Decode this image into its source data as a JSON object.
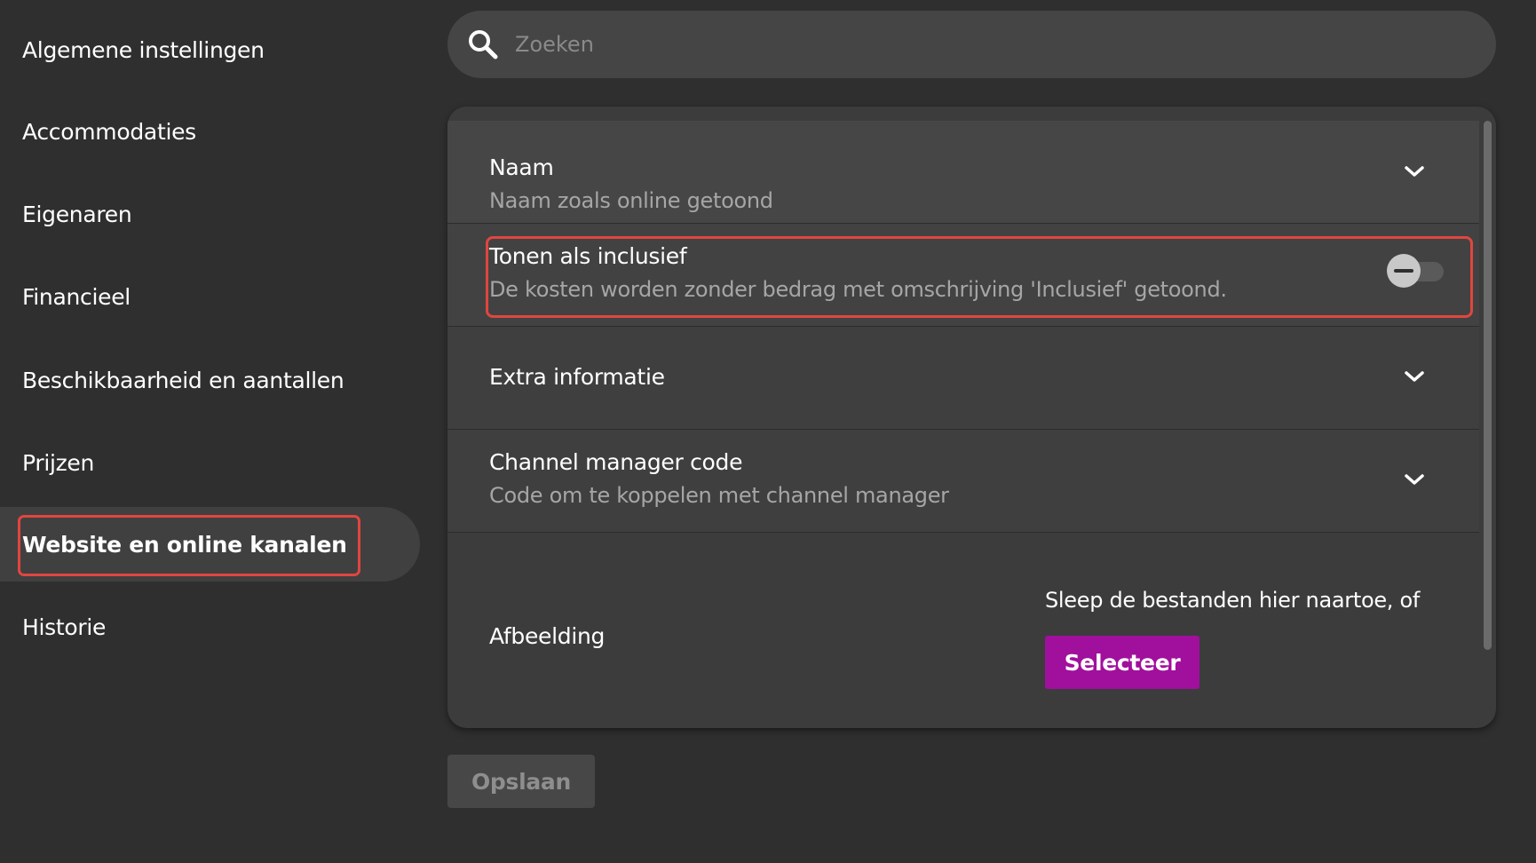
{
  "sidebar": {
    "items": [
      {
        "label": "Algemene instellingen"
      },
      {
        "label": "Accommodaties"
      },
      {
        "label": "Eigenaren"
      },
      {
        "label": "Financieel"
      },
      {
        "label": "Beschikbaarheid en aantallen"
      },
      {
        "label": "Prijzen"
      },
      {
        "label": "Website en online kanalen",
        "active": true
      },
      {
        "label": "Historie"
      }
    ]
  },
  "search": {
    "placeholder": "Zoeken",
    "icon": "search-icon"
  },
  "panel": {
    "rows": [
      {
        "title": "Naam",
        "subtitle": "Naam zoals online getoond",
        "control": "chevron-down-icon"
      },
      {
        "title": "Tonen als inclusief",
        "subtitle": "De kosten worden zonder bedrag met omschrijving 'Inclusief' getoond.",
        "control": "toggle",
        "toggle_on": false
      },
      {
        "title": "Extra informatie",
        "control": "chevron-down-icon"
      },
      {
        "title": "Channel manager code",
        "subtitle": "Code om te koppelen met channel manager",
        "control": "chevron-down-icon"
      },
      {
        "title": "Afbeelding",
        "upload_hint": "Sleep de bestanden hier naartoe, of",
        "upload_button": "Selecteer"
      }
    ]
  },
  "footer": {
    "save_label": "Opslaan"
  },
  "colors": {
    "background": "#2f2f2f",
    "panel": "#3c3c3c",
    "accent_button": "#a10f9d",
    "highlight_border": "#e0463f",
    "active_nav": "#404040"
  }
}
